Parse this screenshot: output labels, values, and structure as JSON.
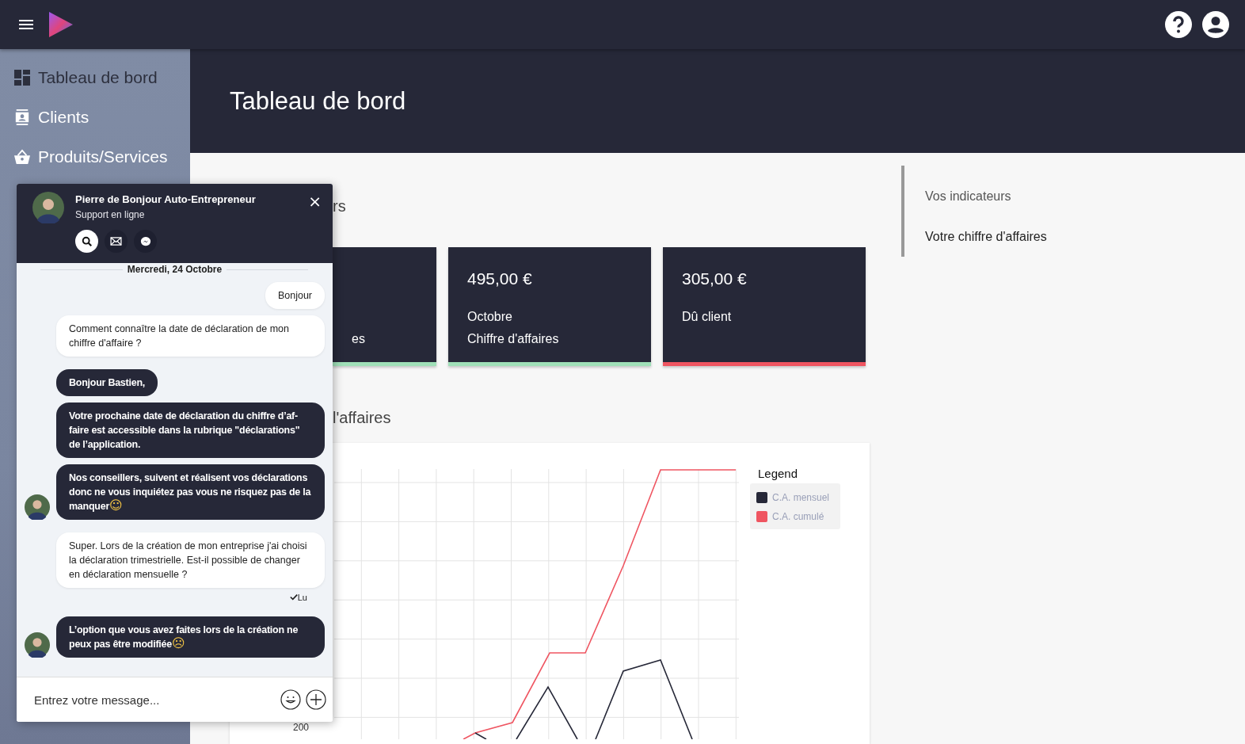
{
  "sidebar": {
    "items": [
      {
        "label": "Tableau de bord",
        "selected": true
      },
      {
        "label": "Clients",
        "selected": false
      },
      {
        "label": "Produits/Services",
        "selected": false
      }
    ]
  },
  "header": {
    "title": "Tableau de bord"
  },
  "indicators": {
    "heading": "rs",
    "cards": [
      {
        "lines": [
          "es"
        ],
        "color": "#a0e0b8"
      },
      {
        "value": "495,00 €",
        "lines": [
          "Octobre",
          "Chiffre d'affaires"
        ],
        "color": "#a0e0b8"
      },
      {
        "value": "305,00 €",
        "lines": [
          "Dû client"
        ],
        "color": "#ef5561"
      }
    ]
  },
  "revenue": {
    "heading": "l'affaires",
    "tick": "200",
    "legend": {
      "title": "Legend",
      "items": [
        {
          "label": "C.A. mensuel",
          "color": "#262838"
        },
        {
          "label": "C.A. cumulé",
          "color": "#ef5561"
        }
      ]
    }
  },
  "page_nav": [
    {
      "label": "Vos indicateurs",
      "selected": false
    },
    {
      "label": "Votre chiffre d'affaires",
      "selected": true
    }
  ],
  "chat": {
    "name": "Pierre de Bonjour Auto-Entrepreneur",
    "status": "Support en ligne",
    "close": "×",
    "channels": [
      {
        "selected": true
      },
      {
        "selected": false
      },
      {
        "selected": false
      }
    ],
    "messages": [
      {
        "kind": "date",
        "text": "Mercredi, 24 Octobre"
      },
      {
        "kind": "user",
        "text": "Bonjour",
        "avatar": false
      },
      {
        "kind": "user",
        "text": "Comment connaître la date de déclaration de mon chiffre d'affaire ?",
        "avatar": false
      },
      {
        "kind": "agent",
        "text": "Bonjour Bastien,",
        "avatar": false
      },
      {
        "kind": "agent",
        "text": "Votre prochaine date de déclaration du chiffre d’af-faire est accessible dans la rubrique \"déclarations\" de l’application.",
        "avatar": false
      },
      {
        "kind": "agent",
        "text": "Nos conseillers, suivent et réalisent vos déclarations donc ne vous inquiétez pas vous ne risquez pas de la manquer",
        "emoji": "☺",
        "avatar": true
      },
      {
        "kind": "user",
        "text": "Super. Lors de la création de mon entreprise j'ai choisi la déclaration trimestrielle. Est-il possible de changer en déclaration mensuelle ?",
        "receipt": "Lu",
        "avatar": false
      },
      {
        "kind": "agent",
        "text": "L’option que vous avez faites lors de la création ne peux pas être modifiée",
        "emoji": "☹",
        "avatar": true
      }
    ],
    "input": {
      "placeholder": "Entrez votre message..."
    }
  }
}
